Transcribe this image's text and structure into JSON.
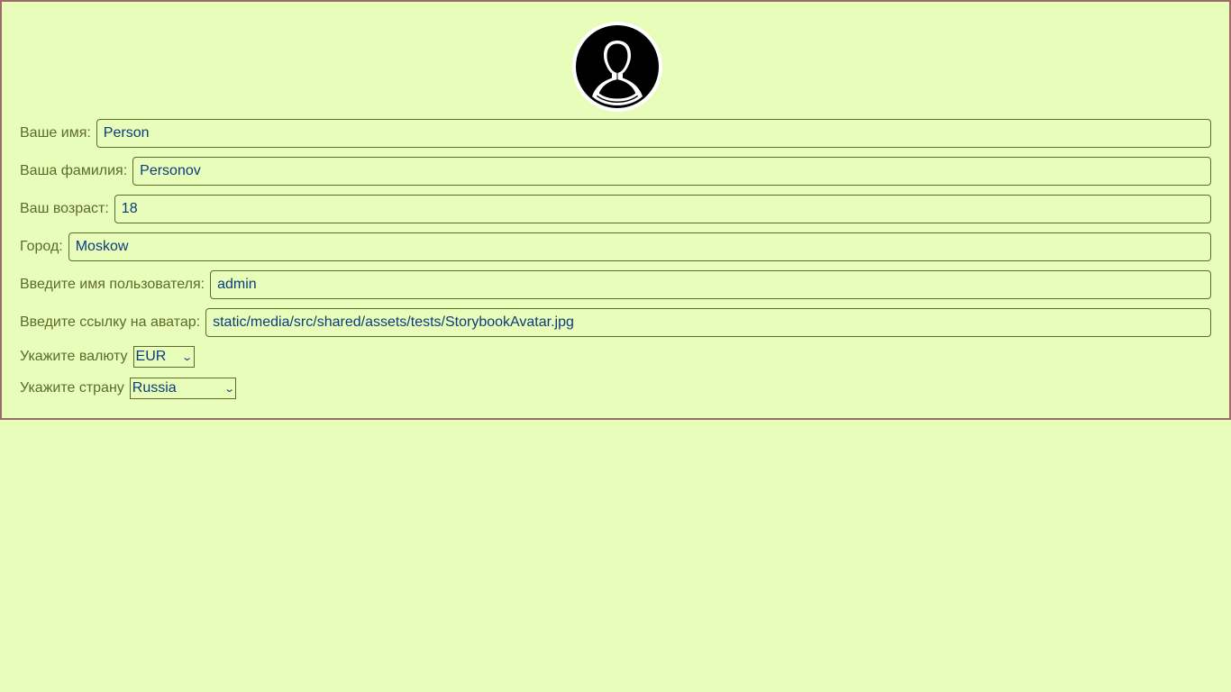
{
  "profile": {
    "avatar_icon": "user-avatar-icon",
    "fields": [
      {
        "label": "Ваше имя:",
        "value": "Person"
      },
      {
        "label": "Ваша фамилия:",
        "value": "Personov"
      },
      {
        "label": "Ваш возраст:",
        "value": "18"
      },
      {
        "label": "Город:",
        "value": "Moskow"
      },
      {
        "label": "Введите имя пользователя:",
        "value": "admin"
      },
      {
        "label": "Введите ссылку на аватар:",
        "value": "static/media/src/shared/assets/tests/StorybookAvatar.jpg"
      }
    ],
    "currency": {
      "label": "Укажите валюту",
      "selected": "EUR"
    },
    "country": {
      "label": "Укажите страну",
      "selected": "Russia"
    }
  },
  "colors": {
    "background": "#e8fdb9",
    "border": "#a06a6a",
    "label_text": "#5e6a2a",
    "value_text": "#0b3c7a"
  }
}
